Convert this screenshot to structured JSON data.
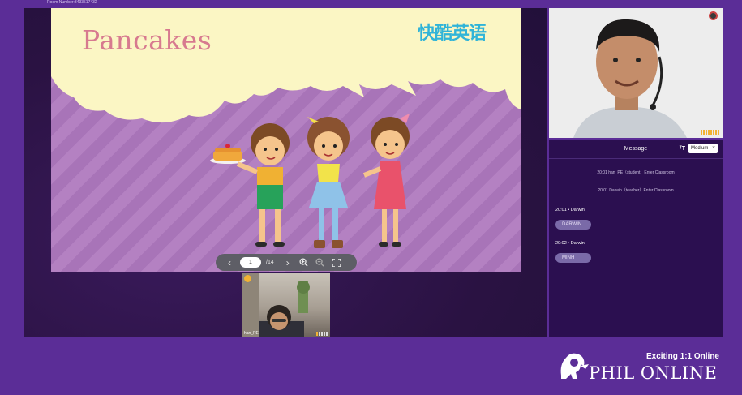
{
  "header": {
    "room_number": "Room Number:3433517432"
  },
  "slide": {
    "title": "Pancakes",
    "logo_text": "快酷英语",
    "nav": {
      "prev_icon": "chevron-left-icon",
      "page": "1",
      "total": "/14",
      "next_icon": "chevron-right-icon",
      "zoom_in_icon": "zoom-in-icon",
      "zoom_out_icon": "zoom-out-icon",
      "fullscreen_icon": "fullscreen-icon"
    }
  },
  "student": {
    "name": "han_PE"
  },
  "chat": {
    "title": "Message",
    "font_size_icon": "font-size-icon",
    "font_size": "Medium",
    "system_messages": [
      "20:01   han_PE（student）Enter Classroom",
      "20:01   Darwin（teacher）Enter Classroom"
    ],
    "messages": [
      {
        "meta": "20:01 • Darwin",
        "text": "DARWIN"
      },
      {
        "meta": "20:02 • Darwin",
        "text": "MINH"
      }
    ]
  },
  "brand": {
    "tagline": "Exciting 1:1 Online",
    "name": "PHIL ONLINE"
  },
  "colors": {
    "background": "#5b2d97",
    "chat_panel": "#2b0f50",
    "slide_title": "#d77a8f",
    "slide_logo": "#30b4d8"
  }
}
